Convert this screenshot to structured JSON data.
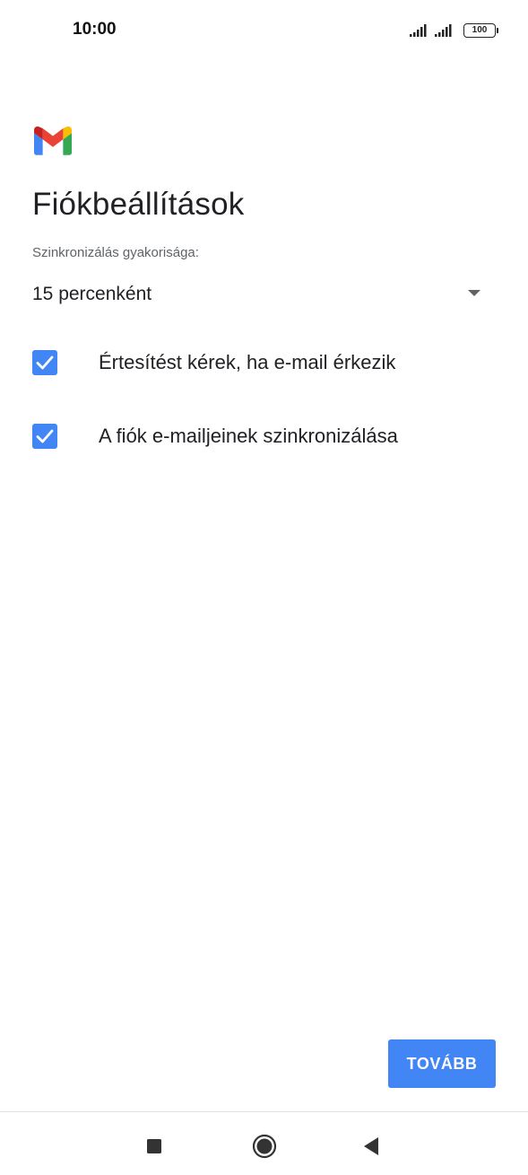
{
  "status_bar": {
    "time": "10:00",
    "battery": "100",
    "icons": [
      "signal-icon",
      "signal-icon",
      "battery-icon"
    ]
  },
  "app": {
    "logo_icon": "gmail-icon"
  },
  "page": {
    "title": "Fiókbeállítások",
    "sync_frequency_label": "Szinkronizálás gyakorisága:",
    "sync_frequency_value": "15 percenként"
  },
  "options": {
    "notify_label": "Értesítést kérek, ha e-mail érkezik",
    "notify_checked": true,
    "sync_label": "A fiók e-mailjeinek szinkronizálása",
    "sync_checked": true
  },
  "actions": {
    "next_label": "TOVÁBB"
  },
  "nav": {
    "icons": [
      "recent-apps-icon",
      "home-icon",
      "back-icon"
    ]
  },
  "colors": {
    "accent": "#4285f4",
    "text_primary": "#202124",
    "text_secondary": "#5f6368"
  }
}
